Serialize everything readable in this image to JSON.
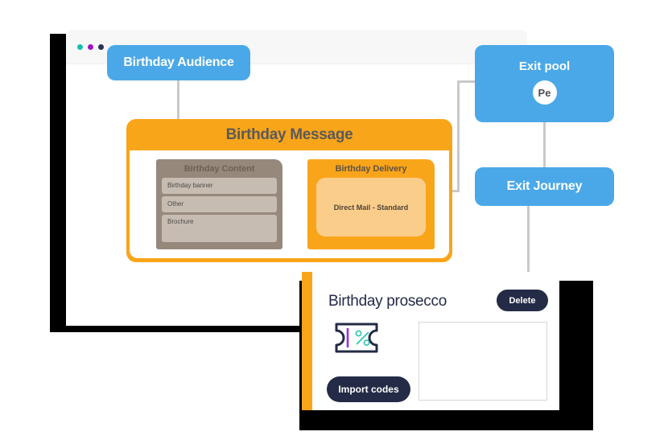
{
  "colors": {
    "blue": "#4aa8e8",
    "orange": "#f9a51a",
    "orange_light": "#fbcd8b",
    "brown": "#97887c",
    "brown_light": "#c6bcb2",
    "navy": "#242b46",
    "connector": "#c9c9c9",
    "dot_teal": "#15bdb4",
    "dot_purple": "#9b16c8",
    "dot_navy": "#2c3254",
    "coupon_purple": "#9b30d9",
    "coupon_teal": "#2fc4b2"
  },
  "browser": {
    "dots": [
      {
        "name": "traffic-light-dot-teal",
        "color": "#15bdb4"
      },
      {
        "name": "traffic-light-dot-purple",
        "color": "#9b16c8"
      },
      {
        "name": "traffic-light-dot-navy",
        "color": "#2c3254"
      }
    ]
  },
  "journey": {
    "audience_node": {
      "label": "Birthday Audience"
    },
    "message_node": {
      "title": "Birthday Message",
      "content_group": {
        "title": "Birthday Content",
        "items": [
          {
            "label": "Birthday banner"
          },
          {
            "label": "Other"
          },
          {
            "label": "Brochure"
          }
        ]
      },
      "delivery_group": {
        "title": "Birthday Delivery",
        "item": "Direct Mail - Standard"
      }
    },
    "exit_pool_node": {
      "label": "Exit pool",
      "badge": "Pe"
    },
    "exit_journey_node": {
      "label": "Exit Journey"
    }
  },
  "detail_panel": {
    "title": "Birthday prosecco",
    "delete_label": "Delete",
    "import_label": "Import codes",
    "coupon_icon_name": "coupon-percent-icon",
    "code_box_value": ""
  }
}
